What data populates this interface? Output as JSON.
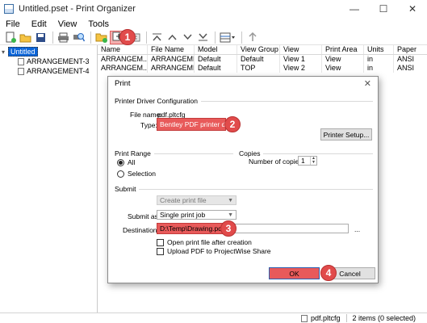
{
  "window": {
    "title": "Untitled.pset - Print Organizer"
  },
  "menu": [
    "File",
    "Edit",
    "View",
    "Tools"
  ],
  "toolbar": {
    "icons": [
      "new-file-icon",
      "open-folder-icon",
      "save-icon",
      "print-icon",
      "print-preview-icon",
      "add-folder-icon",
      "add-file-icon",
      "print-dialog-icon",
      "move-top-icon",
      "move-up-icon",
      "move-down-icon",
      "move-bottom-icon",
      "columns-icon",
      "properties-icon"
    ]
  },
  "callouts": [
    "1",
    "2",
    "3",
    "4"
  ],
  "tree": {
    "root": "Untitled",
    "children": [
      "ARRANGEMENT-3",
      "ARRANGEMENT-4"
    ]
  },
  "grid": {
    "columns": [
      "Name",
      "File Name",
      "Model",
      "View Group",
      "View",
      "Print Area",
      "Units",
      "Paper"
    ],
    "rows": [
      [
        "ARRANGEM...",
        "ARRANGEME...",
        "Default",
        "Default",
        "View 1",
        "View",
        "in",
        "ANSI"
      ],
      [
        "ARRANGEM...",
        "ARRANGEME...",
        "Default",
        "TOP",
        "View 2",
        "View",
        "in",
        "ANSI"
      ]
    ]
  },
  "dialog": {
    "title": "Print",
    "close": "✕",
    "driver_section": "Printer Driver Configuration",
    "file_name_label": "File name:",
    "file_name_value": "pdf.pltcfg",
    "type_label": "Type:",
    "type_value": "Bentley PDF printer driver",
    "printer_setup_button": "Printer Setup...",
    "range_section": "Print Range",
    "radio_all": "All",
    "radio_selection": "Selection",
    "copies_section": "Copies",
    "copies_label": "Number of copies:",
    "copies_value": "1",
    "submit_section": "Submit",
    "create_print_file": "Create print file",
    "submit_as_label": "Submit as:",
    "submit_as_value": "Single print job",
    "destination_label": "Destination:",
    "destination_value": "D:\\Temp\\Drawing.pdf",
    "browse_button": "...",
    "open_after_label": "Open print file after creation",
    "upload_label": "Upload PDF to ProjectWise Share",
    "ok_button": "OK",
    "cancel_button": "Cancel"
  },
  "status": {
    "file": "pdf.pltcfg",
    "count": "2 items (0 selected)"
  },
  "colors": {
    "highlight": "#e85a5a",
    "selection": "#0a64d8"
  }
}
